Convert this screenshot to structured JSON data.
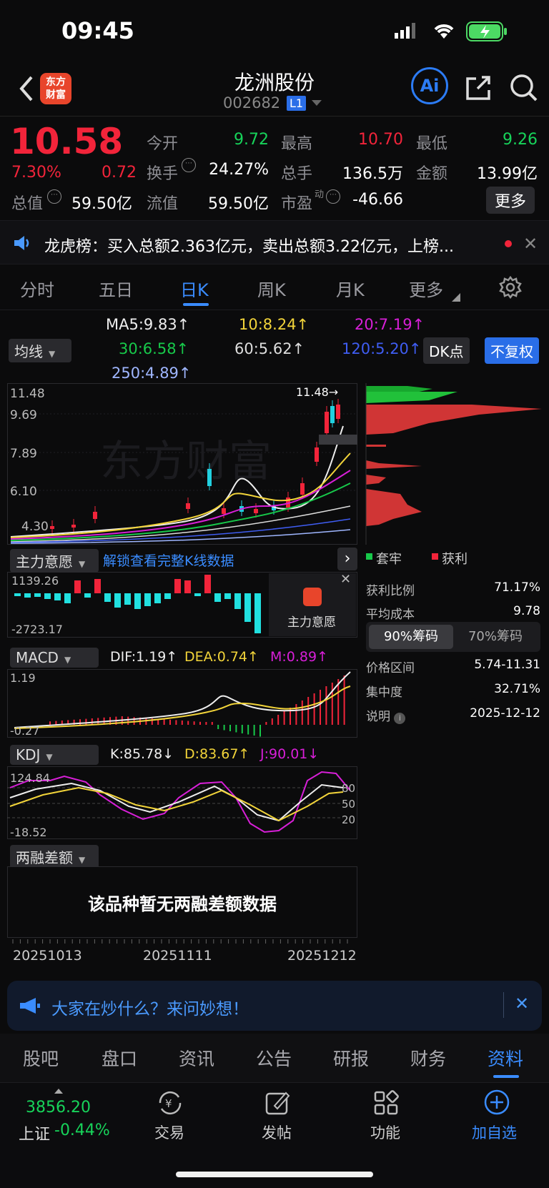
{
  "status": {
    "time": "09:45"
  },
  "header": {
    "logo_line1": "东方",
    "logo_line2": "财富",
    "title": "龙洲股份",
    "code": "002682",
    "level": "L1",
    "ai_label": "Ai"
  },
  "quote": {
    "price": "10.58",
    "change_pct": "7.30%",
    "change_amt": "0.72",
    "open_label": "今开",
    "open": "9.72",
    "high_label": "最高",
    "high": "10.70",
    "low_label": "最低",
    "low": "9.26",
    "turnover_label": "换手",
    "turnover": "24.27%",
    "volume_label": "总手",
    "volume": "136.5万",
    "amount_label": "金额",
    "amount": "13.99亿",
    "mcap_label": "总值",
    "mcap": "59.50亿",
    "float_label": "流值",
    "float": "59.50亿",
    "pe_label": "市盈",
    "pe_sup": "动",
    "pe": "-46.66",
    "more_label": "更多"
  },
  "notice": {
    "text": "龙虎榜：买入总额2.363亿元，卖出总额3.22亿元，上榜..."
  },
  "ktabs": [
    "分时",
    "五日",
    "日K",
    "周K",
    "月K",
    "更多"
  ],
  "ma": {
    "selector": "均线",
    "ma5": "MA5:9.83↑",
    "ma10": "10:8.24↑",
    "ma20": "20:7.19↑",
    "ma30": "30:6.58↑",
    "ma60": "60:5.62↑",
    "ma120": "120:5.20↑",
    "ma250": "250:4.89↑",
    "dk": "DK点",
    "fq": "不复权"
  },
  "kchart": {
    "y1": "11.48",
    "y2": "9.69",
    "y3": "7.89",
    "y4": "6.10",
    "y5": "4.30",
    "maxmark": "11.48→",
    "watermark": "东方财富"
  },
  "chip": {
    "trap_label": "套牢",
    "profit_label": "获利",
    "rows": [
      {
        "k": "获利比例",
        "v": "71.17%"
      },
      {
        "k": "平均成本",
        "v": "9.78"
      }
    ],
    "tab90": "90%筹码",
    "tab70": "70%筹码",
    "rows2": [
      {
        "k": "价格区间",
        "v": "5.74-11.31"
      },
      {
        "k": "集中度",
        "v": "32.71%"
      },
      {
        "k": "说明",
        "v": "2025-12-12"
      }
    ]
  },
  "flow": {
    "selector": "主力意愿",
    "unlock": "解锁查看完整K线数据",
    "top": "1139.26",
    "bottom": "-2723.17",
    "card": "主力意愿"
  },
  "macd": {
    "selector": "MACD",
    "dif": "DIF:1.19↑",
    "dea": "DEA:0.74↑",
    "m": "M:0.89↑",
    "top": "1.19",
    "bottom": "-0.27"
  },
  "kdj": {
    "selector": "KDJ",
    "k": "K:85.78↓",
    "d": "D:83.67↑",
    "j": "J:90.01↓",
    "top": "124.84",
    "bottom": "-18.52",
    "l80": "80",
    "l50": "50",
    "l20": "20"
  },
  "margin": {
    "selector": "两融差额",
    "empty": "该品种暂无两融差额数据"
  },
  "dates": [
    "20251013",
    "20251111",
    "20251212"
  ],
  "chat": {
    "text": "大家在炒什么？来问妙想！"
  },
  "btabs": [
    "股吧",
    "盘口",
    "资讯",
    "公告",
    "研报",
    "财务",
    "资料"
  ],
  "bnav": {
    "index_value": "3856.20",
    "index_name": "上证",
    "index_change": "-0.44%",
    "trade": "交易",
    "post": "发帖",
    "func": "功能",
    "add": "加自选"
  }
}
